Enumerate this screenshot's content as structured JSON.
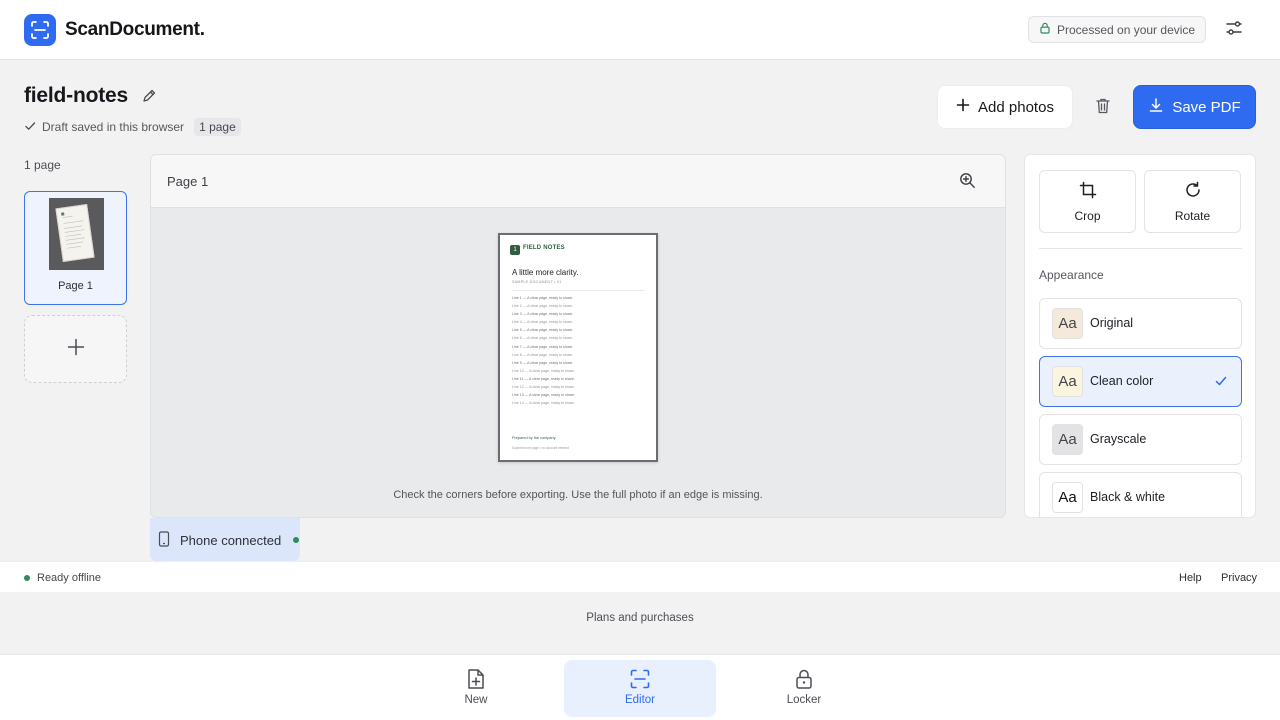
{
  "header": {
    "brand": "ScanDocument.",
    "privacy_note": "Processed on your device"
  },
  "document": {
    "title": "field-notes",
    "draft_status": "Draft saved in this browser",
    "page_count": "1 page"
  },
  "actions": {
    "add_photos": "Add photos",
    "save_pdf": "Save PDF"
  },
  "thumbnails": {
    "count_label": "1 page",
    "pages": [
      {
        "label": "Page 1"
      }
    ]
  },
  "preview": {
    "title": "Page 1",
    "hint": "Check the corners before exporting. Use the full photo if an edge is missing.",
    "doc": {
      "mark": "1",
      "brand": "FIELD NOTES",
      "heading": "A little more clarity.",
      "subheading": "SAMPLE DOCUMENT • 01",
      "lines": [
        "Line 1 — A clear page, ready to share.",
        "Line 2 — A clear page, ready to share.",
        "Line 3 — A clear page, ready to share.",
        "Line 4 — A clear page, ready to share.",
        "Line 5 — A clear page, ready to share.",
        "Line 6 — A clear page, ready to share.",
        "Line 7 — A clear page, ready to share.",
        "Line 8 — A clear page, ready to share.",
        "Line 9 — A clear page, ready to share.",
        "Line 10 — A clear page, ready to share.",
        "Line 11 — A clear page, ready to share.",
        "Line 12 — A clear page, ready to share.",
        "Line 13 — A clear page, ready to share.",
        "Line 14 — A clear page, ready to share."
      ],
      "footer_1": "Prepared by the company",
      "footer_2": "Scanned one page • no account needed"
    }
  },
  "tools": {
    "crop": "Crop",
    "rotate": "Rotate",
    "appearance_label": "Appearance",
    "options": [
      {
        "name": "Original",
        "swatch": "Aa",
        "bg": "#f5ead9",
        "selected": false
      },
      {
        "name": "Clean color",
        "swatch": "Aa",
        "bg": "#fbf4de",
        "selected": true
      },
      {
        "name": "Grayscale",
        "swatch": "Aa",
        "bg": "#e3e3e5",
        "selected": false
      },
      {
        "name": "Black & white",
        "swatch": "Aa",
        "bg": "#ffffff",
        "selected": false
      }
    ]
  },
  "phone": {
    "label": "Phone connected"
  },
  "status": {
    "offline": "Ready offline",
    "help": "Help",
    "privacy": "Privacy"
  },
  "plans": {
    "label": "Plans and purchases"
  },
  "nav": [
    {
      "label": "New",
      "icon": "new-document-icon",
      "active": false
    },
    {
      "label": "Editor",
      "icon": "scan-icon",
      "active": true
    },
    {
      "label": "Locker",
      "icon": "lock-icon",
      "active": false
    }
  ],
  "colors": {
    "accent": "#2f6bf0",
    "online_dot": "#2f8a5e",
    "doc_brand": "#2e5e3e"
  }
}
